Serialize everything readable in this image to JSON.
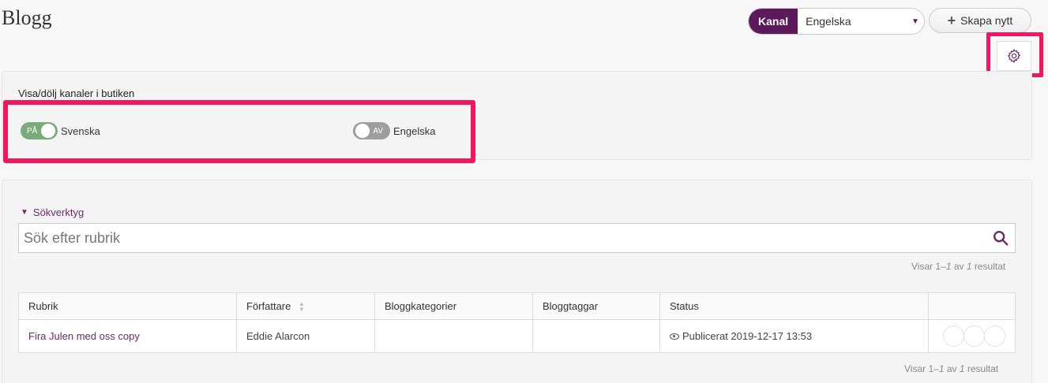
{
  "page": {
    "title": "Blogg"
  },
  "header": {
    "channel_label": "Kanal",
    "channel_value": "Engelska",
    "create_label": "Skapa nytt"
  },
  "channels_panel": {
    "heading": "Visa/dölj kanaler i butiken",
    "toggles": [
      {
        "state_label": "PÅ",
        "on": true,
        "name": "Svenska"
      },
      {
        "state_label": "AV",
        "on": false,
        "name": "Engelska"
      }
    ]
  },
  "search": {
    "tools_label": "Sökverktyg",
    "placeholder": "Sök efter rubrik"
  },
  "results": {
    "prefix": "Visar 1–",
    "shown": "1",
    "middle": " av ",
    "total": "1",
    "suffix": " resultat"
  },
  "table": {
    "columns": [
      "Rubrik",
      "Författare",
      "Bloggkategorier",
      "Bloggtaggar",
      "Status",
      ""
    ],
    "rows": [
      {
        "title": "Fira Julen med oss copy",
        "author": "Eddie Alarcon",
        "categories": "",
        "tags": "",
        "status": "Publicerat 2019-12-17 13:53"
      }
    ]
  },
  "colors": {
    "brand": "#5c1a5c",
    "link": "#6b2a6b",
    "highlight": "#f5145f",
    "toggle_on": "#7aab7a",
    "toggle_off": "#9e9e9e"
  },
  "icons": [
    "plus-icon",
    "gear-icon",
    "caret-down-icon",
    "triangle-down-icon",
    "search-icon",
    "eye-icon",
    "sort-icon"
  ]
}
